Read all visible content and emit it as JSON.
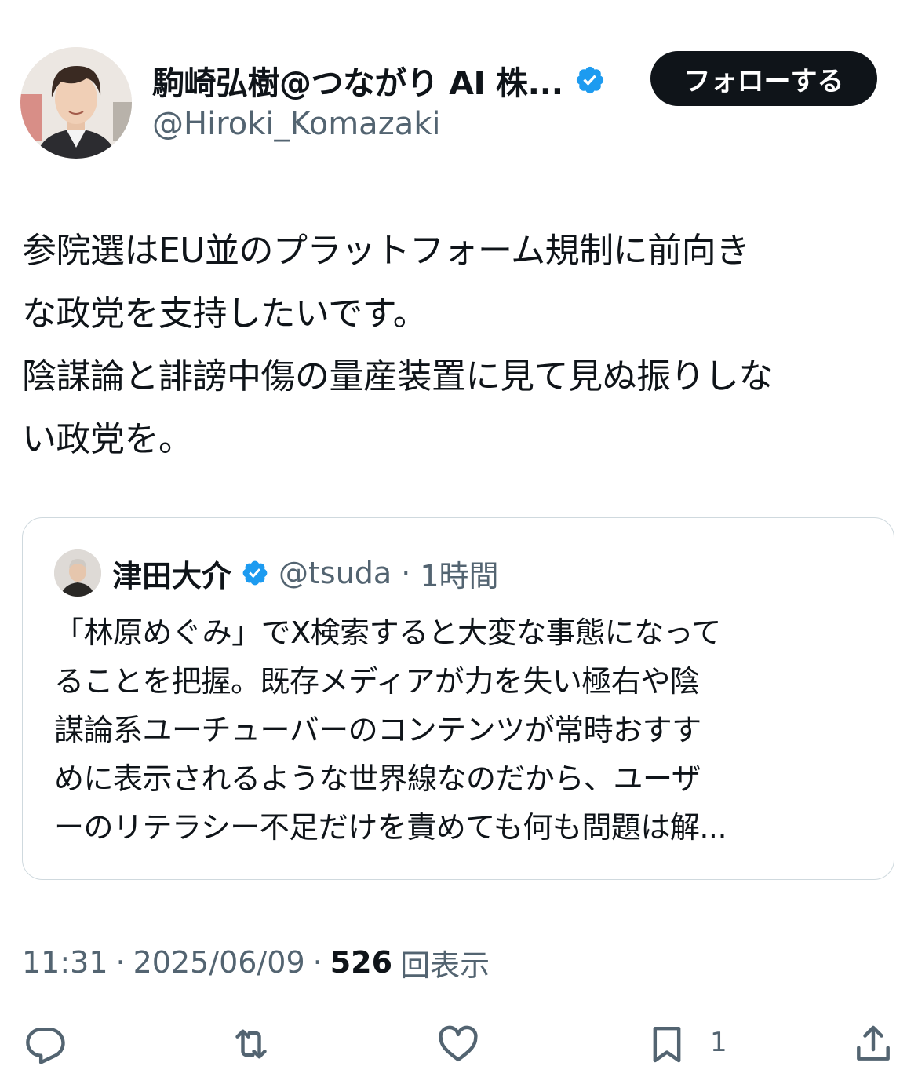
{
  "author": {
    "display_name": "駒崎弘樹@つながり AI 株...",
    "handle": "@Hiroki_Komazaki",
    "verified_color": "#1d9bf0"
  },
  "follow_button": {
    "label": "フォローする"
  },
  "tweet": {
    "text": "参院選はEU並のプラットフォーム規制に前向き\nな政党を支持したいです。\n陰謀論と誹謗中傷の量産装置に見て見ぬ振りしな\nい政党を。"
  },
  "quoted_tweet": {
    "display_name": "津田大介",
    "handle": "@tsuda",
    "separator": "·",
    "time": "1時間",
    "text": "「林原めぐみ」でX検索すると大変な事態になって\nることを把握。既存メディアが力を失い極右や陰\n謀論系ユーチューバーのコンテンツが常時おすす\nめに表示されるような世界線なのだから、ユーザ\nーのリテラシー不足だけを責めても何も問題は解..."
  },
  "meta": {
    "time": "11:31",
    "sep1": "·",
    "date": "2025/06/09",
    "sep2": "·",
    "views_count": "526",
    "views_label": "回表示"
  },
  "actions": {
    "icons": [
      "reply-icon",
      "retweet-icon",
      "like-icon",
      "bookmark-icon",
      "share-icon"
    ],
    "bookmark_count": "1"
  }
}
